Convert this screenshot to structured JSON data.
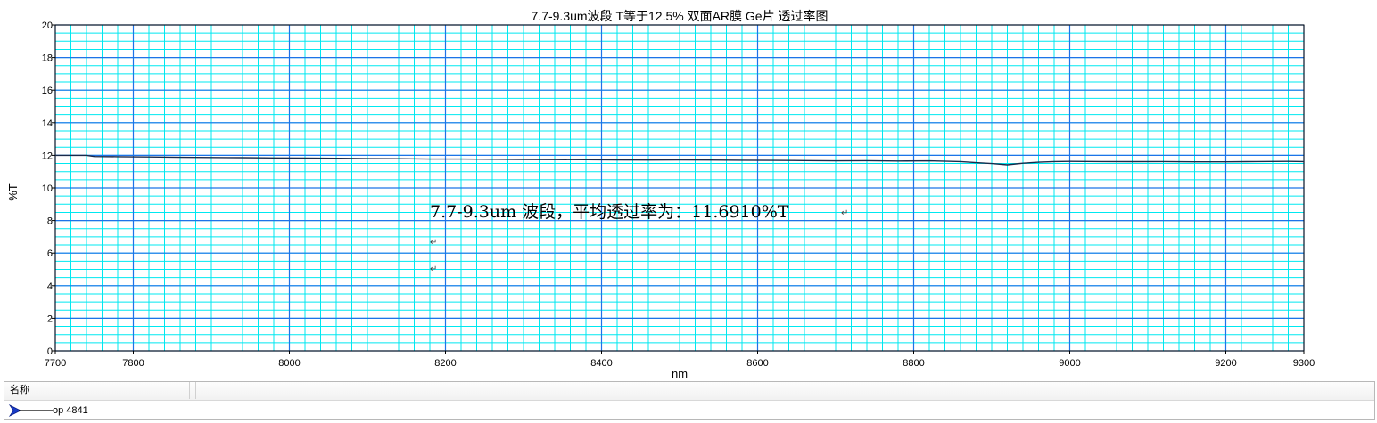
{
  "chart_data": {
    "type": "line",
    "title": "7.7-9.3um波段 T等于12.5% 双面AR膜 Ge片 透过率图",
    "xlabel": "nm",
    "ylabel": "%T",
    "xlim": [
      7700,
      9300
    ],
    "ylim": [
      0,
      20
    ],
    "xticks": [
      7700,
      7800,
      8000,
      8200,
      8400,
      8600,
      8800,
      9000,
      9200,
      9300
    ],
    "xtick_labels": [
      "7700",
      "7800",
      "8000",
      "8200",
      "8400",
      "8600",
      "8800",
      "9000",
      "9200",
      "9300"
    ],
    "yticks": [
      0,
      2,
      4,
      6,
      8,
      10,
      12,
      14,
      16,
      18,
      20
    ],
    "ytick_labels": [
      "0",
      "2",
      "4",
      "6",
      "8",
      "10",
      "12",
      "14",
      "16",
      "18",
      "20"
    ],
    "grid": true,
    "series": [
      {
        "name": "op 4841",
        "color": "#1a2a4a",
        "x": [
          7700,
          7740,
          7750,
          7780,
          7820,
          7860,
          7900,
          7940,
          7980,
          8020,
          8060,
          8100,
          8140,
          8180,
          8220,
          8260,
          8300,
          8340,
          8380,
          8420,
          8460,
          8500,
          8540,
          8580,
          8620,
          8660,
          8700,
          8740,
          8780,
          8820,
          8860,
          8880,
          8900,
          8920,
          8940,
          8960,
          8980,
          9000,
          9040,
          9080,
          9120,
          9160,
          9200,
          9240,
          9280,
          9300
        ],
        "y": [
          12.0,
          12.0,
          11.93,
          11.92,
          11.9,
          11.88,
          11.87,
          11.86,
          11.84,
          11.83,
          11.82,
          11.8,
          11.79,
          11.77,
          11.77,
          11.76,
          11.75,
          11.74,
          11.73,
          11.72,
          11.71,
          11.72,
          11.71,
          11.7,
          11.69,
          11.68,
          11.66,
          11.67,
          11.65,
          11.66,
          11.62,
          11.55,
          11.5,
          11.42,
          11.52,
          11.58,
          11.62,
          11.63,
          11.62,
          11.61,
          11.62,
          11.6,
          11.6,
          11.62,
          11.63,
          11.62
        ]
      }
    ],
    "annotation": {
      "text": "7.7-9.3um 波段，平均透过率为：11.6910%T",
      "return_mark": "↵"
    },
    "colors": {
      "minor_grid": "#00e8f0",
      "major_grid": "#1e73e8",
      "line": "#1a2a4a"
    }
  },
  "legend": {
    "header": "名称",
    "items": [
      {
        "label": "op 4841",
        "color": "#1a3cc8"
      }
    ]
  }
}
